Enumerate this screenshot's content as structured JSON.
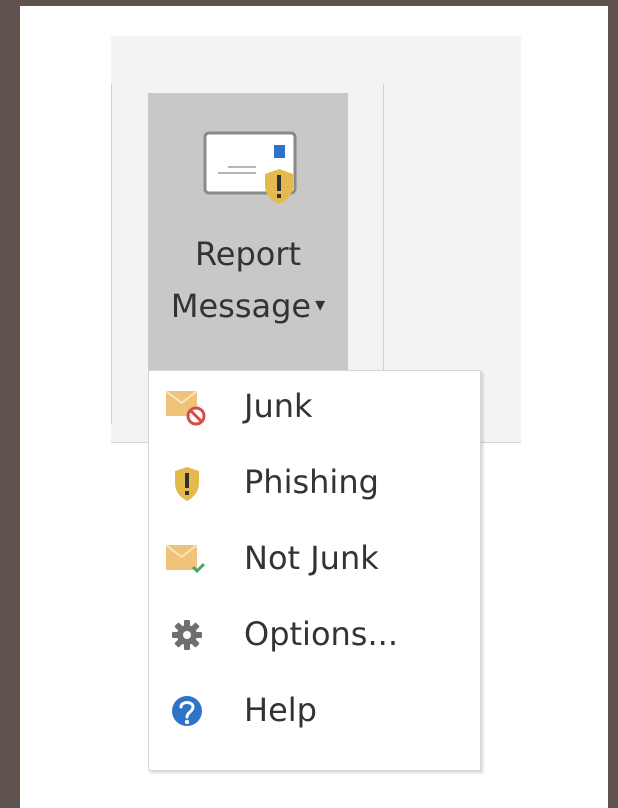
{
  "ribbon": {
    "report_button": {
      "line1": "Report",
      "line2": "Message"
    }
  },
  "menu": {
    "items": [
      {
        "label": "Junk",
        "icon": "junk-icon"
      },
      {
        "label": "Phishing",
        "icon": "phishing-icon"
      },
      {
        "label": "Not Junk",
        "icon": "not-junk-icon"
      },
      {
        "label": "Options...",
        "icon": "gear-icon"
      },
      {
        "label": "Help",
        "icon": "help-icon"
      }
    ]
  },
  "colors": {
    "background": "#5f514c",
    "ribbon": "#f3f3f3",
    "button_active": "#c8c8c8",
    "envelope": "#efc37a",
    "shield": "#e6b94e",
    "blue": "#2e73c7",
    "red": "#d94b45",
    "green": "#45a95f",
    "text": "#333333"
  }
}
